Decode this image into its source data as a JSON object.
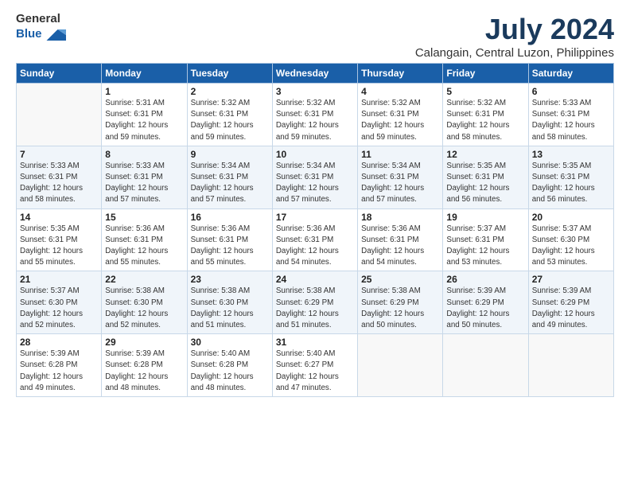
{
  "logo": {
    "general": "General",
    "blue": "Blue"
  },
  "title": "July 2024",
  "subtitle": "Calangain, Central Luzon, Philippines",
  "headers": [
    "Sunday",
    "Monday",
    "Tuesday",
    "Wednesday",
    "Thursday",
    "Friday",
    "Saturday"
  ],
  "weeks": [
    [
      {
        "day": "",
        "info": ""
      },
      {
        "day": "1",
        "info": "Sunrise: 5:31 AM\nSunset: 6:31 PM\nDaylight: 12 hours\nand 59 minutes."
      },
      {
        "day": "2",
        "info": "Sunrise: 5:32 AM\nSunset: 6:31 PM\nDaylight: 12 hours\nand 59 minutes."
      },
      {
        "day": "3",
        "info": "Sunrise: 5:32 AM\nSunset: 6:31 PM\nDaylight: 12 hours\nand 59 minutes."
      },
      {
        "day": "4",
        "info": "Sunrise: 5:32 AM\nSunset: 6:31 PM\nDaylight: 12 hours\nand 59 minutes."
      },
      {
        "day": "5",
        "info": "Sunrise: 5:32 AM\nSunset: 6:31 PM\nDaylight: 12 hours\nand 58 minutes."
      },
      {
        "day": "6",
        "info": "Sunrise: 5:33 AM\nSunset: 6:31 PM\nDaylight: 12 hours\nand 58 minutes."
      }
    ],
    [
      {
        "day": "7",
        "info": "Sunrise: 5:33 AM\nSunset: 6:31 PM\nDaylight: 12 hours\nand 58 minutes."
      },
      {
        "day": "8",
        "info": "Sunrise: 5:33 AM\nSunset: 6:31 PM\nDaylight: 12 hours\nand 57 minutes."
      },
      {
        "day": "9",
        "info": "Sunrise: 5:34 AM\nSunset: 6:31 PM\nDaylight: 12 hours\nand 57 minutes."
      },
      {
        "day": "10",
        "info": "Sunrise: 5:34 AM\nSunset: 6:31 PM\nDaylight: 12 hours\nand 57 minutes."
      },
      {
        "day": "11",
        "info": "Sunrise: 5:34 AM\nSunset: 6:31 PM\nDaylight: 12 hours\nand 57 minutes."
      },
      {
        "day": "12",
        "info": "Sunrise: 5:35 AM\nSunset: 6:31 PM\nDaylight: 12 hours\nand 56 minutes."
      },
      {
        "day": "13",
        "info": "Sunrise: 5:35 AM\nSunset: 6:31 PM\nDaylight: 12 hours\nand 56 minutes."
      }
    ],
    [
      {
        "day": "14",
        "info": "Sunrise: 5:35 AM\nSunset: 6:31 PM\nDaylight: 12 hours\nand 55 minutes."
      },
      {
        "day": "15",
        "info": "Sunrise: 5:36 AM\nSunset: 6:31 PM\nDaylight: 12 hours\nand 55 minutes."
      },
      {
        "day": "16",
        "info": "Sunrise: 5:36 AM\nSunset: 6:31 PM\nDaylight: 12 hours\nand 55 minutes."
      },
      {
        "day": "17",
        "info": "Sunrise: 5:36 AM\nSunset: 6:31 PM\nDaylight: 12 hours\nand 54 minutes."
      },
      {
        "day": "18",
        "info": "Sunrise: 5:36 AM\nSunset: 6:31 PM\nDaylight: 12 hours\nand 54 minutes."
      },
      {
        "day": "19",
        "info": "Sunrise: 5:37 AM\nSunset: 6:31 PM\nDaylight: 12 hours\nand 53 minutes."
      },
      {
        "day": "20",
        "info": "Sunrise: 5:37 AM\nSunset: 6:30 PM\nDaylight: 12 hours\nand 53 minutes."
      }
    ],
    [
      {
        "day": "21",
        "info": "Sunrise: 5:37 AM\nSunset: 6:30 PM\nDaylight: 12 hours\nand 52 minutes."
      },
      {
        "day": "22",
        "info": "Sunrise: 5:38 AM\nSunset: 6:30 PM\nDaylight: 12 hours\nand 52 minutes."
      },
      {
        "day": "23",
        "info": "Sunrise: 5:38 AM\nSunset: 6:30 PM\nDaylight: 12 hours\nand 51 minutes."
      },
      {
        "day": "24",
        "info": "Sunrise: 5:38 AM\nSunset: 6:29 PM\nDaylight: 12 hours\nand 51 minutes."
      },
      {
        "day": "25",
        "info": "Sunrise: 5:38 AM\nSunset: 6:29 PM\nDaylight: 12 hours\nand 50 minutes."
      },
      {
        "day": "26",
        "info": "Sunrise: 5:39 AM\nSunset: 6:29 PM\nDaylight: 12 hours\nand 50 minutes."
      },
      {
        "day": "27",
        "info": "Sunrise: 5:39 AM\nSunset: 6:29 PM\nDaylight: 12 hours\nand 49 minutes."
      }
    ],
    [
      {
        "day": "28",
        "info": "Sunrise: 5:39 AM\nSunset: 6:28 PM\nDaylight: 12 hours\nand 49 minutes."
      },
      {
        "day": "29",
        "info": "Sunrise: 5:39 AM\nSunset: 6:28 PM\nDaylight: 12 hours\nand 48 minutes."
      },
      {
        "day": "30",
        "info": "Sunrise: 5:40 AM\nSunset: 6:28 PM\nDaylight: 12 hours\nand 48 minutes."
      },
      {
        "day": "31",
        "info": "Sunrise: 5:40 AM\nSunset: 6:27 PM\nDaylight: 12 hours\nand 47 minutes."
      },
      {
        "day": "",
        "info": ""
      },
      {
        "day": "",
        "info": ""
      },
      {
        "day": "",
        "info": ""
      }
    ]
  ]
}
